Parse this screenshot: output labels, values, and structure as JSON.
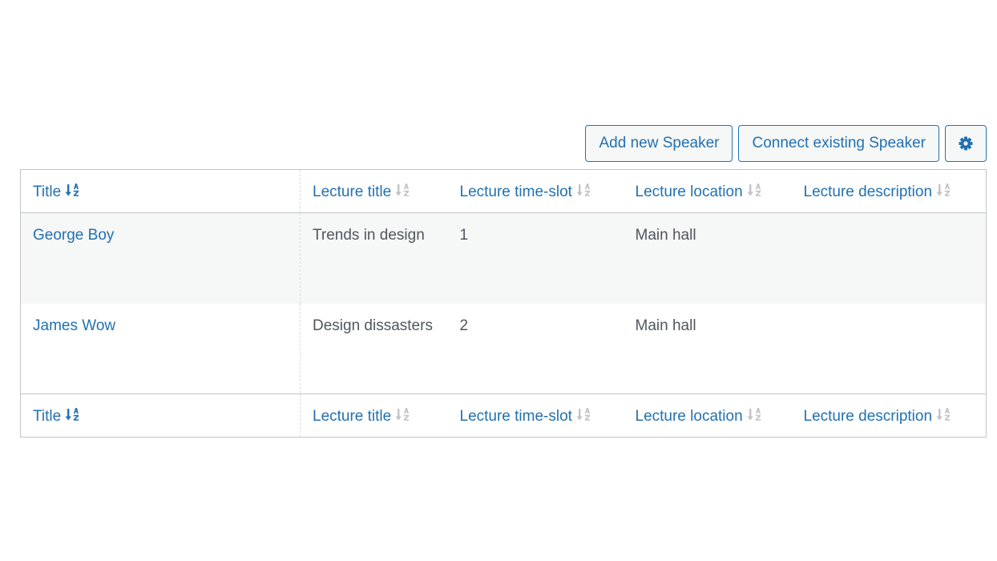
{
  "toolbar": {
    "add_label": "Add new Speaker",
    "connect_label": "Connect existing Speaker",
    "settings_icon": "gear-icon"
  },
  "columns": [
    {
      "label": "Title",
      "sorted": true
    },
    {
      "label": "Lecture title",
      "sorted": false
    },
    {
      "label": "Lecture time-slot",
      "sorted": false
    },
    {
      "label": "Lecture location",
      "sorted": false
    },
    {
      "label": "Lecture description",
      "sorted": false
    }
  ],
  "rows": [
    {
      "title": "George Boy",
      "lecture_title": "Trends in design",
      "time_slot": "1",
      "location": "Main hall",
      "description": ""
    },
    {
      "title": "James Wow",
      "lecture_title": "Design dissasters",
      "time_slot": "2",
      "location": "Main hall",
      "description": ""
    }
  ],
  "colors": {
    "accent": "#2271b1",
    "row_alt": "#f6f7f7",
    "border": "#c3c4c7",
    "sort_inactive": "#c3c4c7"
  }
}
